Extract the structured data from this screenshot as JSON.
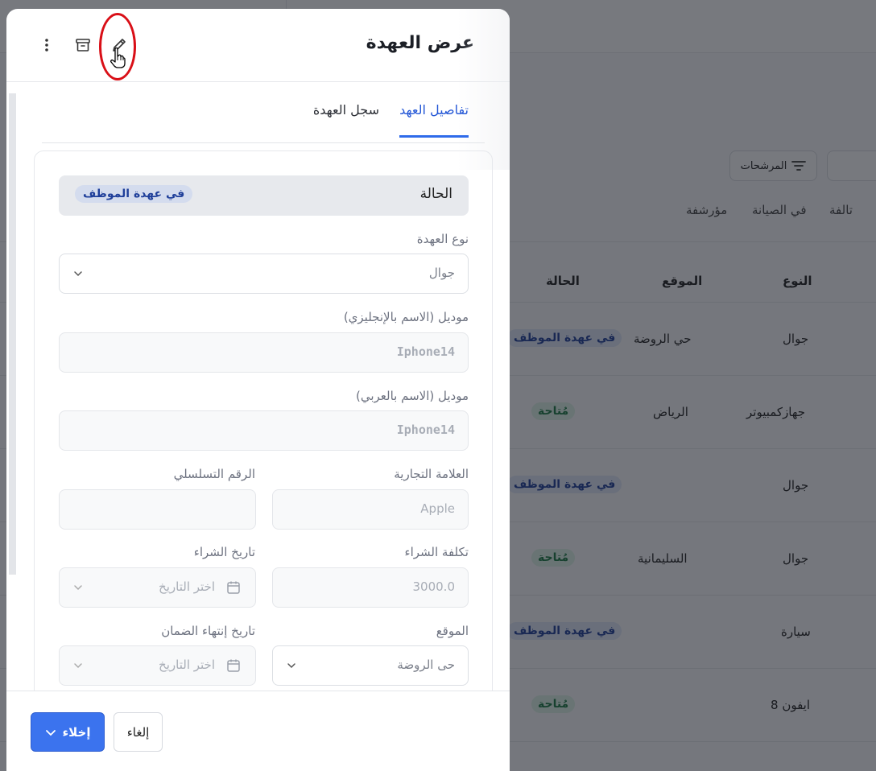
{
  "background": {
    "filters_label": "المرشحات",
    "status_tabs": [
      "تالفة",
      "في الصيانة",
      "مؤرشفة"
    ],
    "table": {
      "headers": {
        "type": "النوع",
        "location": "الموقع",
        "status": "الحالة"
      },
      "rows": [
        {
          "type": "جوال",
          "location": "حي الروضة",
          "status": "في عهدة الموظف",
          "status_kind": "assigned"
        },
        {
          "type": "جهازكمبيوتر",
          "location": "الرياض",
          "status": "مُتاحة",
          "status_kind": "available"
        },
        {
          "type": "جوال",
          "location": "",
          "status": "في عهدة الموظف",
          "status_kind": "assigned"
        },
        {
          "type": "جوال",
          "location": "السليمانية",
          "status": "مُتاحة",
          "status_kind": "available"
        },
        {
          "type": "سيارة",
          "location": "",
          "status": "في عهدة الموظف",
          "status_kind": "assigned"
        },
        {
          "type": "ايفون 8",
          "location": "",
          "status": "مُتاحة",
          "status_kind": "available"
        }
      ]
    }
  },
  "drawer": {
    "title": "عرض العهدة",
    "icons": {
      "more": "more-vertical-icon",
      "archive": "archive-icon",
      "edit": "pencil-icon",
      "cursor": "hand-pointer-icon"
    },
    "tabs": [
      {
        "label": "تفاصيل العهد",
        "active": true
      },
      {
        "label": "سجل العهدة",
        "active": false
      }
    ],
    "status": {
      "label": "الحالة",
      "value": "في عهدة الموظف"
    },
    "fields": {
      "custody_type": {
        "label": "نوع العهدة",
        "value": "جوال"
      },
      "model_en": {
        "label": "موديل (الاسم بالإنجليزي)",
        "value": "Iphone14"
      },
      "model_ar": {
        "label": "موديل (الاسم بالعربي)",
        "value": "Iphone14"
      },
      "brand": {
        "label": "العلامة التجارية",
        "value": "Apple"
      },
      "serial": {
        "label": "الرقم التسلسلي",
        "value": ""
      },
      "purchase_cost": {
        "label": "تكلفة الشراء",
        "value": "3000.0"
      },
      "purchase_date": {
        "label": "تاريخ الشراء",
        "placeholder": "اختر التاريخ"
      },
      "location": {
        "label": "الموقع",
        "value": "حى الروضة"
      },
      "warranty_end": {
        "label": "تاريخ إنتهاء الضمان",
        "placeholder": "اختر التاريخ"
      }
    },
    "footer": {
      "primary_label": "إخلاء",
      "cancel_label": "إلغاء"
    }
  },
  "colors": {
    "accent": "#3b73ee",
    "highlight": "#d90f17",
    "assigned_text": "#1f3f9a",
    "available_text": "#1b7a44"
  }
}
